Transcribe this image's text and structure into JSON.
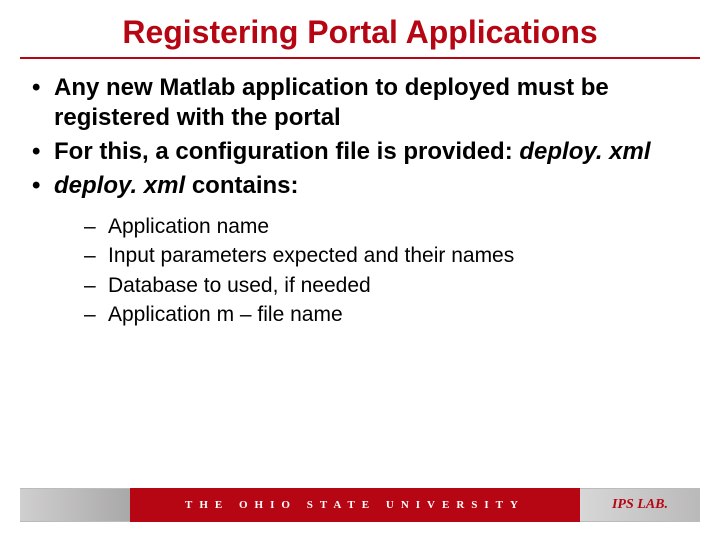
{
  "title": "Registering Portal Applications",
  "bullets": {
    "b0": {
      "text_a": "Any new Matlab application to deployed must be registered with the portal"
    },
    "b1": {
      "text_a": "For this, a configuration file is provided: ",
      "italic": "deploy. xml"
    },
    "b2": {
      "italic": "deploy. xml",
      "text_b": " contains:"
    }
  },
  "sub": {
    "s0": "Application name",
    "s1": "Input parameters expected and their names",
    "s2": "Database to used, if needed",
    "s3": "Application m – file name"
  },
  "footer": {
    "university": "THE OHIO STATE UNIVERSITY",
    "lab": "IPS LAB."
  }
}
